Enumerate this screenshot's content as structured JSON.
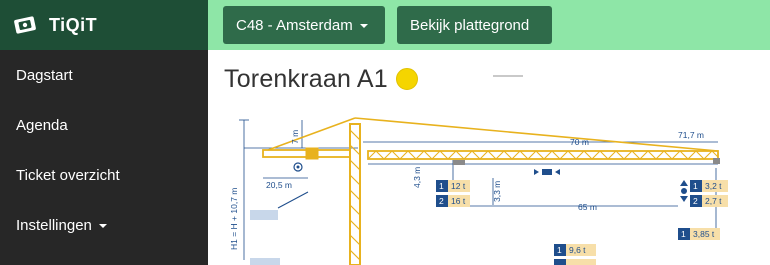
{
  "brand": {
    "name": "TiQiT"
  },
  "sidebar": {
    "items": [
      {
        "label": "Dagstart"
      },
      {
        "label": "Agenda"
      },
      {
        "label": "Ticket overzicht"
      },
      {
        "label": "Instellingen"
      }
    ]
  },
  "topbar": {
    "location_label": "C48 - Amsterdam",
    "map_button_label": "Bekijk plattegrond"
  },
  "page": {
    "title": "Torenkraan A1",
    "status_color": "#f5d500"
  },
  "crane_diagram": {
    "labels": {
      "h1": "H1 = H + 10,7 m",
      "top_height": "7 m",
      "counter_jib": "20,5 m",
      "jib_total": "71,7 m",
      "jib_mid": "70 m",
      "hook_height": "4,3 m",
      "trolley_gap": "3,3 m",
      "inner_span": "65 m"
    },
    "loads": [
      {
        "num": "1",
        "value": "12 t"
      },
      {
        "num": "2",
        "value": "16 t"
      },
      {
        "num": "1",
        "value": "3,2 t"
      },
      {
        "num": "2",
        "value": "2,7 t"
      },
      {
        "num": "1",
        "value": "3,85 t"
      },
      {
        "num": "1",
        "value": "9,6 t"
      }
    ]
  },
  "colors": {
    "sidebar_bg": "#272727",
    "brand_bg": "#1e4e36",
    "topbar_bg": "#8ee6a7",
    "button_bg": "#2f6b4a",
    "crane_yellow": "#e8b21e",
    "diagram_blue": "#1f4e8c"
  }
}
